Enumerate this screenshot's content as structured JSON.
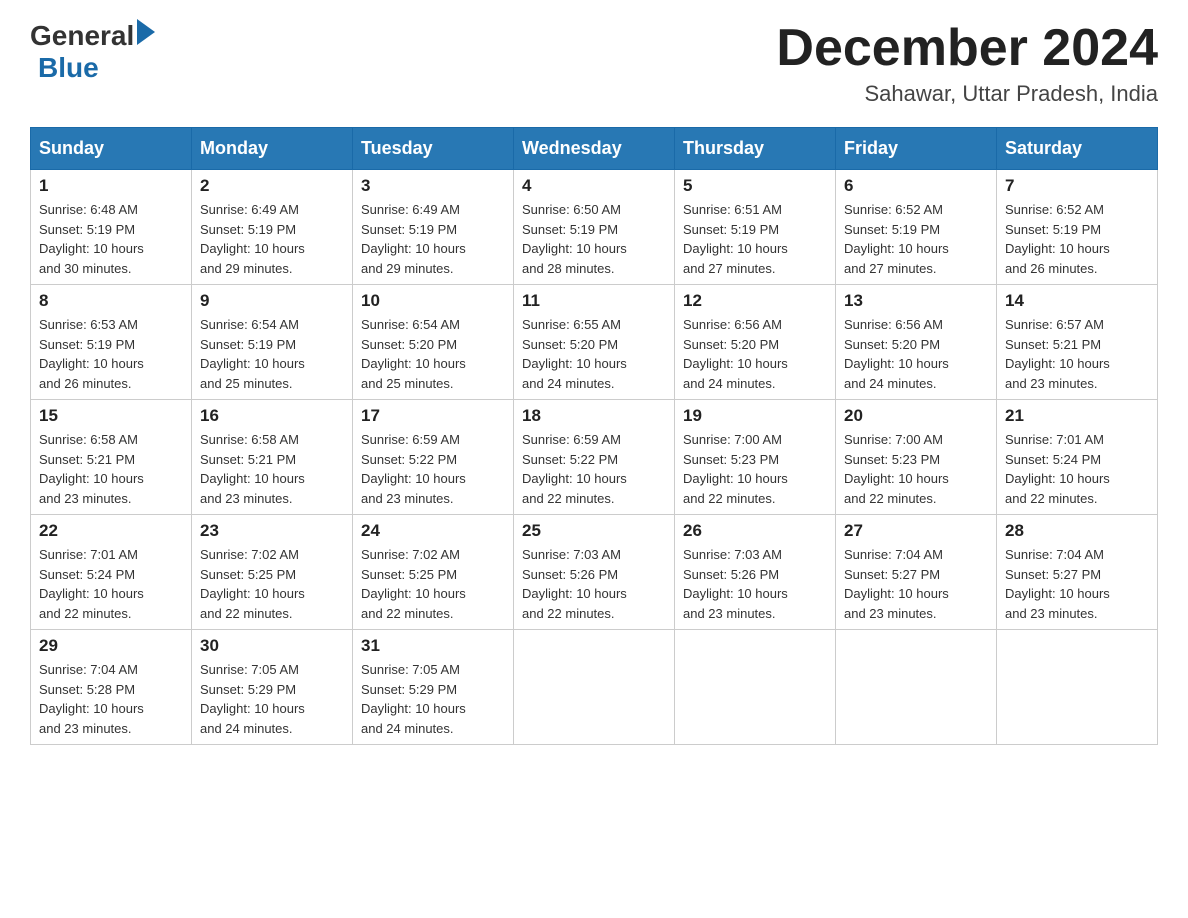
{
  "header": {
    "logo_general": "General",
    "logo_blue": "Blue",
    "title": "December 2024",
    "location": "Sahawar, Uttar Pradesh, India"
  },
  "days_of_week": [
    "Sunday",
    "Monday",
    "Tuesday",
    "Wednesday",
    "Thursday",
    "Friday",
    "Saturday"
  ],
  "weeks": [
    [
      {
        "day": "1",
        "sunrise": "6:48 AM",
        "sunset": "5:19 PM",
        "daylight": "10 hours and 30 minutes."
      },
      {
        "day": "2",
        "sunrise": "6:49 AM",
        "sunset": "5:19 PM",
        "daylight": "10 hours and 29 minutes."
      },
      {
        "day": "3",
        "sunrise": "6:49 AM",
        "sunset": "5:19 PM",
        "daylight": "10 hours and 29 minutes."
      },
      {
        "day": "4",
        "sunrise": "6:50 AM",
        "sunset": "5:19 PM",
        "daylight": "10 hours and 28 minutes."
      },
      {
        "day": "5",
        "sunrise": "6:51 AM",
        "sunset": "5:19 PM",
        "daylight": "10 hours and 27 minutes."
      },
      {
        "day": "6",
        "sunrise": "6:52 AM",
        "sunset": "5:19 PM",
        "daylight": "10 hours and 27 minutes."
      },
      {
        "day": "7",
        "sunrise": "6:52 AM",
        "sunset": "5:19 PM",
        "daylight": "10 hours and 26 minutes."
      }
    ],
    [
      {
        "day": "8",
        "sunrise": "6:53 AM",
        "sunset": "5:19 PM",
        "daylight": "10 hours and 26 minutes."
      },
      {
        "day": "9",
        "sunrise": "6:54 AM",
        "sunset": "5:19 PM",
        "daylight": "10 hours and 25 minutes."
      },
      {
        "day": "10",
        "sunrise": "6:54 AM",
        "sunset": "5:20 PM",
        "daylight": "10 hours and 25 minutes."
      },
      {
        "day": "11",
        "sunrise": "6:55 AM",
        "sunset": "5:20 PM",
        "daylight": "10 hours and 24 minutes."
      },
      {
        "day": "12",
        "sunrise": "6:56 AM",
        "sunset": "5:20 PM",
        "daylight": "10 hours and 24 minutes."
      },
      {
        "day": "13",
        "sunrise": "6:56 AM",
        "sunset": "5:20 PM",
        "daylight": "10 hours and 24 minutes."
      },
      {
        "day": "14",
        "sunrise": "6:57 AM",
        "sunset": "5:21 PM",
        "daylight": "10 hours and 23 minutes."
      }
    ],
    [
      {
        "day": "15",
        "sunrise": "6:58 AM",
        "sunset": "5:21 PM",
        "daylight": "10 hours and 23 minutes."
      },
      {
        "day": "16",
        "sunrise": "6:58 AM",
        "sunset": "5:21 PM",
        "daylight": "10 hours and 23 minutes."
      },
      {
        "day": "17",
        "sunrise": "6:59 AM",
        "sunset": "5:22 PM",
        "daylight": "10 hours and 23 minutes."
      },
      {
        "day": "18",
        "sunrise": "6:59 AM",
        "sunset": "5:22 PM",
        "daylight": "10 hours and 22 minutes."
      },
      {
        "day": "19",
        "sunrise": "7:00 AM",
        "sunset": "5:23 PM",
        "daylight": "10 hours and 22 minutes."
      },
      {
        "day": "20",
        "sunrise": "7:00 AM",
        "sunset": "5:23 PM",
        "daylight": "10 hours and 22 minutes."
      },
      {
        "day": "21",
        "sunrise": "7:01 AM",
        "sunset": "5:24 PM",
        "daylight": "10 hours and 22 minutes."
      }
    ],
    [
      {
        "day": "22",
        "sunrise": "7:01 AM",
        "sunset": "5:24 PM",
        "daylight": "10 hours and 22 minutes."
      },
      {
        "day": "23",
        "sunrise": "7:02 AM",
        "sunset": "5:25 PM",
        "daylight": "10 hours and 22 minutes."
      },
      {
        "day": "24",
        "sunrise": "7:02 AM",
        "sunset": "5:25 PM",
        "daylight": "10 hours and 22 minutes."
      },
      {
        "day": "25",
        "sunrise": "7:03 AM",
        "sunset": "5:26 PM",
        "daylight": "10 hours and 22 minutes."
      },
      {
        "day": "26",
        "sunrise": "7:03 AM",
        "sunset": "5:26 PM",
        "daylight": "10 hours and 23 minutes."
      },
      {
        "day": "27",
        "sunrise": "7:04 AM",
        "sunset": "5:27 PM",
        "daylight": "10 hours and 23 minutes."
      },
      {
        "day": "28",
        "sunrise": "7:04 AM",
        "sunset": "5:27 PM",
        "daylight": "10 hours and 23 minutes."
      }
    ],
    [
      {
        "day": "29",
        "sunrise": "7:04 AM",
        "sunset": "5:28 PM",
        "daylight": "10 hours and 23 minutes."
      },
      {
        "day": "30",
        "sunrise": "7:05 AM",
        "sunset": "5:29 PM",
        "daylight": "10 hours and 24 minutes."
      },
      {
        "day": "31",
        "sunrise": "7:05 AM",
        "sunset": "5:29 PM",
        "daylight": "10 hours and 24 minutes."
      },
      null,
      null,
      null,
      null
    ]
  ],
  "labels": {
    "sunrise": "Sunrise:",
    "sunset": "Sunset:",
    "daylight": "Daylight:"
  }
}
